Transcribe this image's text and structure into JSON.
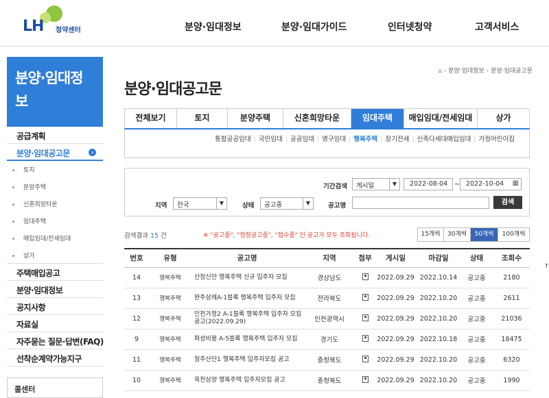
{
  "header": {
    "logo_text": "LH",
    "logo_sub": "청약센터",
    "nav": [
      "분양·임대정보",
      "분양·임대가이드",
      "인터넷청약",
      "고객서비스"
    ]
  },
  "sidebar": {
    "title": "분양·임대정보",
    "menu": [
      {
        "label": "공급계획",
        "level": 1
      },
      {
        "label": "분양·임대공고문",
        "level": 1,
        "active": true
      },
      {
        "label": "토지",
        "level": 2
      },
      {
        "label": "분양주택",
        "level": 2
      },
      {
        "label": "신혼희망타운",
        "level": 2
      },
      {
        "label": "임대주택",
        "level": 2
      },
      {
        "label": "매입임대/전세임대",
        "level": 2
      },
      {
        "label": "상가",
        "level": 2
      },
      {
        "label": "주택매입공고",
        "level": 1
      },
      {
        "label": "분양·임대정보",
        "level": 1
      },
      {
        "label": "공지사항",
        "level": 1
      },
      {
        "label": "자료실",
        "level": 1
      },
      {
        "label": "자주묻는 질문·답변(FAQ)",
        "level": 1
      },
      {
        "label": "선착순계약가능지구",
        "level": 1
      }
    ],
    "footer_label": "콜센터"
  },
  "breadcrumb": {
    "home_icon": "home-icon",
    "items": [
      "분양·임대정보",
      "분양·임대공고문"
    ]
  },
  "page_title": "분양·임대공고문",
  "tabs": [
    {
      "label": "전체보기"
    },
    {
      "label": "토지"
    },
    {
      "label": "분양주택"
    },
    {
      "label": "신혼희망타운"
    },
    {
      "label": "임대주택",
      "active": true
    },
    {
      "label": "매입임대/전세임대"
    },
    {
      "label": "상가"
    }
  ],
  "subtabs": [
    {
      "label": "통합공공임대"
    },
    {
      "label": "국민임대"
    },
    {
      "label": "공공임대"
    },
    {
      "label": "영구임대"
    },
    {
      "label": "행복주택",
      "active": true
    },
    {
      "label": "장기전세"
    },
    {
      "label": "신축다세대매입임대"
    },
    {
      "label": "가정어린이집"
    }
  ],
  "search": {
    "period_label": "기간검색",
    "period_type": "게시일",
    "date_from": "2022-08-04",
    "date_sep": "~",
    "date_to": "2022-10-04",
    "region_label": "지역",
    "region_value": "전국",
    "status_label": "상태",
    "status_value": "공고중",
    "name_label": "공고명",
    "name_value": "",
    "button": "검색"
  },
  "results": {
    "prefix": "검색결과",
    "count": "15",
    "suffix": "건",
    "note": "※ \"공고중\", \"정정공고중\", \"접수중\" 인 공고가 모두 조회됩니다.",
    "page_sizes": [
      {
        "label": "15개씩"
      },
      {
        "label": "30개씩"
      },
      {
        "label": "50개씩",
        "active": true
      },
      {
        "label": "100개씩"
      }
    ]
  },
  "table": {
    "headers": [
      "번호",
      "유형",
      "공고명",
      "지역",
      "첨부",
      "게시일",
      "마감일",
      "상태",
      "조회수"
    ],
    "rows": [
      {
        "no": "14",
        "type": "행복주택",
        "title": "산청신안 행복주택 신규 입주자 모집",
        "region": "경상남도",
        "posted": "2022.09.29",
        "deadline": "2022.10.14",
        "status": "공고중",
        "views": "2180"
      },
      {
        "no": "13",
        "type": "행복주택",
        "title": "완주삼례A-1블록 행복주택 입주자 모집",
        "region": "전라북도",
        "posted": "2022.09.29",
        "deadline": "2022.10.20",
        "status": "공고중",
        "views": "2611"
      },
      {
        "no": "12",
        "type": "행복주택",
        "title": "인천가정2 A-1블록 행복주택 입주자 모집공고(2022.09.29)",
        "region": "인천광역시",
        "posted": "2022.09.29",
        "deadline": "2022.10.20",
        "status": "공고중",
        "views": "21036"
      },
      {
        "no": "9",
        "type": "행복주택",
        "title": "화성비봉 A-5블록 행복주택 입주자 모집",
        "region": "경기도",
        "posted": "2022.09.29",
        "deadline": "2022.10.18",
        "status": "공고중",
        "views": "18475"
      },
      {
        "no": "11",
        "type": "행복주택",
        "title": "청주산단1 행복주택 입주자모집 공고",
        "region": "충청북도",
        "posted": "2022.09.29",
        "deadline": "2022.10.20",
        "status": "공고중",
        "views": "6320"
      },
      {
        "no": "10",
        "type": "행복주택",
        "title": "옥천삼양 행복주택 입주자모집 공고",
        "region": "충청북도",
        "posted": "2022.09.29",
        "deadline": "2022.10.20",
        "status": "공고중",
        "views": "1990"
      }
    ]
  },
  "edge_text": "T"
}
